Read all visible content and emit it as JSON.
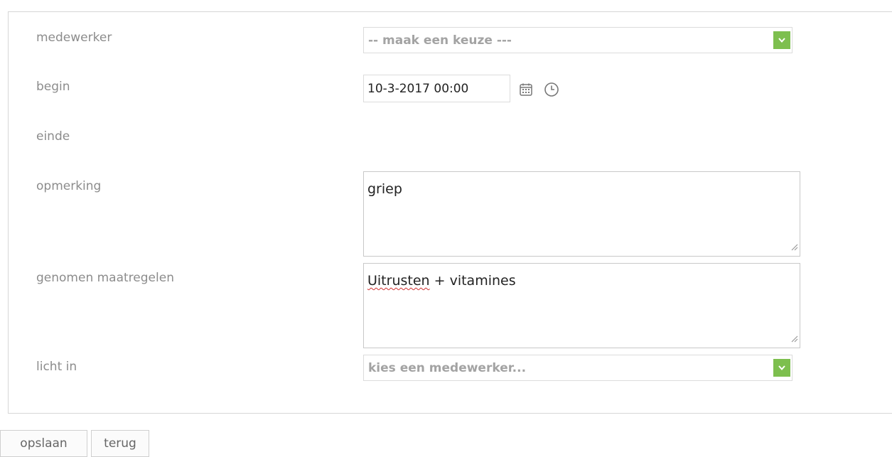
{
  "form": {
    "fields": {
      "medewerker": {
        "label": "medewerker",
        "value": "-- maak een keuze ---"
      },
      "begin": {
        "label": "begin",
        "value": "10-3-2017 00:00"
      },
      "einde": {
        "label": "einde"
      },
      "opmerking": {
        "label": "opmerking",
        "value": "griep"
      },
      "genomen_maatregelen": {
        "label": "genomen maatregelen",
        "value_misspelled": "Uitrusten",
        "value_rest": " + vitamines"
      },
      "licht_in": {
        "label": "licht in",
        "value": "kies een medewerker..."
      }
    }
  },
  "buttons": {
    "save": "opslaan",
    "back": "terug"
  },
  "icons": {
    "dropdown": "chevron-down-icon",
    "calendar": "calendar-icon",
    "clock": "clock-icon",
    "resize": "resize-grip-icon"
  },
  "colors": {
    "accent": "#7dbf4e",
    "label": "#8c8c8c",
    "spellcheck": "#d03030"
  }
}
